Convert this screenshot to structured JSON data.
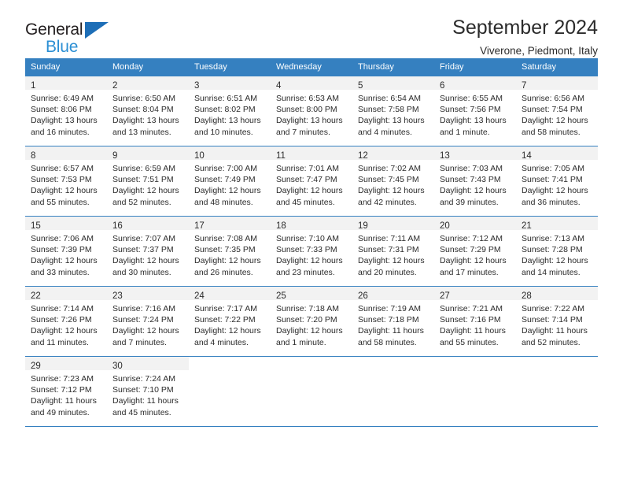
{
  "brand": {
    "name_top": "General",
    "name_bottom": "Blue",
    "triangle_color": "#1d6eb7",
    "blue_color": "#2b8fd4"
  },
  "header": {
    "title": "September 2024",
    "subtitle": "Viverone, Piedmont, Italy"
  },
  "colors": {
    "header_blue": "#3580c0",
    "daynum_band": "#f2f2f2",
    "text": "#2b2b2b"
  },
  "weekday_headers": [
    "Sunday",
    "Monday",
    "Tuesday",
    "Wednesday",
    "Thursday",
    "Friday",
    "Saturday"
  ],
  "weeks": [
    [
      {
        "day": "1",
        "sunrise": "Sunrise: 6:49 AM",
        "sunset": "Sunset: 8:06 PM",
        "daylight_line1": "Daylight: 13 hours",
        "daylight_line2": "and 16 minutes."
      },
      {
        "day": "2",
        "sunrise": "Sunrise: 6:50 AM",
        "sunset": "Sunset: 8:04 PM",
        "daylight_line1": "Daylight: 13 hours",
        "daylight_line2": "and 13 minutes."
      },
      {
        "day": "3",
        "sunrise": "Sunrise: 6:51 AM",
        "sunset": "Sunset: 8:02 PM",
        "daylight_line1": "Daylight: 13 hours",
        "daylight_line2": "and 10 minutes."
      },
      {
        "day": "4",
        "sunrise": "Sunrise: 6:53 AM",
        "sunset": "Sunset: 8:00 PM",
        "daylight_line1": "Daylight: 13 hours",
        "daylight_line2": "and 7 minutes."
      },
      {
        "day": "5",
        "sunrise": "Sunrise: 6:54 AM",
        "sunset": "Sunset: 7:58 PM",
        "daylight_line1": "Daylight: 13 hours",
        "daylight_line2": "and 4 minutes."
      },
      {
        "day": "6",
        "sunrise": "Sunrise: 6:55 AM",
        "sunset": "Sunset: 7:56 PM",
        "daylight_line1": "Daylight: 13 hours",
        "daylight_line2": "and 1 minute."
      },
      {
        "day": "7",
        "sunrise": "Sunrise: 6:56 AM",
        "sunset": "Sunset: 7:54 PM",
        "daylight_line1": "Daylight: 12 hours",
        "daylight_line2": "and 58 minutes."
      }
    ],
    [
      {
        "day": "8",
        "sunrise": "Sunrise: 6:57 AM",
        "sunset": "Sunset: 7:53 PM",
        "daylight_line1": "Daylight: 12 hours",
        "daylight_line2": "and 55 minutes."
      },
      {
        "day": "9",
        "sunrise": "Sunrise: 6:59 AM",
        "sunset": "Sunset: 7:51 PM",
        "daylight_line1": "Daylight: 12 hours",
        "daylight_line2": "and 52 minutes."
      },
      {
        "day": "10",
        "sunrise": "Sunrise: 7:00 AM",
        "sunset": "Sunset: 7:49 PM",
        "daylight_line1": "Daylight: 12 hours",
        "daylight_line2": "and 48 minutes."
      },
      {
        "day": "11",
        "sunrise": "Sunrise: 7:01 AM",
        "sunset": "Sunset: 7:47 PM",
        "daylight_line1": "Daylight: 12 hours",
        "daylight_line2": "and 45 minutes."
      },
      {
        "day": "12",
        "sunrise": "Sunrise: 7:02 AM",
        "sunset": "Sunset: 7:45 PM",
        "daylight_line1": "Daylight: 12 hours",
        "daylight_line2": "and 42 minutes."
      },
      {
        "day": "13",
        "sunrise": "Sunrise: 7:03 AM",
        "sunset": "Sunset: 7:43 PM",
        "daylight_line1": "Daylight: 12 hours",
        "daylight_line2": "and 39 minutes."
      },
      {
        "day": "14",
        "sunrise": "Sunrise: 7:05 AM",
        "sunset": "Sunset: 7:41 PM",
        "daylight_line1": "Daylight: 12 hours",
        "daylight_line2": "and 36 minutes."
      }
    ],
    [
      {
        "day": "15",
        "sunrise": "Sunrise: 7:06 AM",
        "sunset": "Sunset: 7:39 PM",
        "daylight_line1": "Daylight: 12 hours",
        "daylight_line2": "and 33 minutes."
      },
      {
        "day": "16",
        "sunrise": "Sunrise: 7:07 AM",
        "sunset": "Sunset: 7:37 PM",
        "daylight_line1": "Daylight: 12 hours",
        "daylight_line2": "and 30 minutes."
      },
      {
        "day": "17",
        "sunrise": "Sunrise: 7:08 AM",
        "sunset": "Sunset: 7:35 PM",
        "daylight_line1": "Daylight: 12 hours",
        "daylight_line2": "and 26 minutes."
      },
      {
        "day": "18",
        "sunrise": "Sunrise: 7:10 AM",
        "sunset": "Sunset: 7:33 PM",
        "daylight_line1": "Daylight: 12 hours",
        "daylight_line2": "and 23 minutes."
      },
      {
        "day": "19",
        "sunrise": "Sunrise: 7:11 AM",
        "sunset": "Sunset: 7:31 PM",
        "daylight_line1": "Daylight: 12 hours",
        "daylight_line2": "and 20 minutes."
      },
      {
        "day": "20",
        "sunrise": "Sunrise: 7:12 AM",
        "sunset": "Sunset: 7:29 PM",
        "daylight_line1": "Daylight: 12 hours",
        "daylight_line2": "and 17 minutes."
      },
      {
        "day": "21",
        "sunrise": "Sunrise: 7:13 AM",
        "sunset": "Sunset: 7:28 PM",
        "daylight_line1": "Daylight: 12 hours",
        "daylight_line2": "and 14 minutes."
      }
    ],
    [
      {
        "day": "22",
        "sunrise": "Sunrise: 7:14 AM",
        "sunset": "Sunset: 7:26 PM",
        "daylight_line1": "Daylight: 12 hours",
        "daylight_line2": "and 11 minutes."
      },
      {
        "day": "23",
        "sunrise": "Sunrise: 7:16 AM",
        "sunset": "Sunset: 7:24 PM",
        "daylight_line1": "Daylight: 12 hours",
        "daylight_line2": "and 7 minutes."
      },
      {
        "day": "24",
        "sunrise": "Sunrise: 7:17 AM",
        "sunset": "Sunset: 7:22 PM",
        "daylight_line1": "Daylight: 12 hours",
        "daylight_line2": "and 4 minutes."
      },
      {
        "day": "25",
        "sunrise": "Sunrise: 7:18 AM",
        "sunset": "Sunset: 7:20 PM",
        "daylight_line1": "Daylight: 12 hours",
        "daylight_line2": "and 1 minute."
      },
      {
        "day": "26",
        "sunrise": "Sunrise: 7:19 AM",
        "sunset": "Sunset: 7:18 PM",
        "daylight_line1": "Daylight: 11 hours",
        "daylight_line2": "and 58 minutes."
      },
      {
        "day": "27",
        "sunrise": "Sunrise: 7:21 AM",
        "sunset": "Sunset: 7:16 PM",
        "daylight_line1": "Daylight: 11 hours",
        "daylight_line2": "and 55 minutes."
      },
      {
        "day": "28",
        "sunrise": "Sunrise: 7:22 AM",
        "sunset": "Sunset: 7:14 PM",
        "daylight_line1": "Daylight: 11 hours",
        "daylight_line2": "and 52 minutes."
      }
    ],
    [
      {
        "day": "29",
        "sunrise": "Sunrise: 7:23 AM",
        "sunset": "Sunset: 7:12 PM",
        "daylight_line1": "Daylight: 11 hours",
        "daylight_line2": "and 49 minutes."
      },
      {
        "day": "30",
        "sunrise": "Sunrise: 7:24 AM",
        "sunset": "Sunset: 7:10 PM",
        "daylight_line1": "Daylight: 11 hours",
        "daylight_line2": "and 45 minutes."
      },
      null,
      null,
      null,
      null,
      null
    ]
  ]
}
